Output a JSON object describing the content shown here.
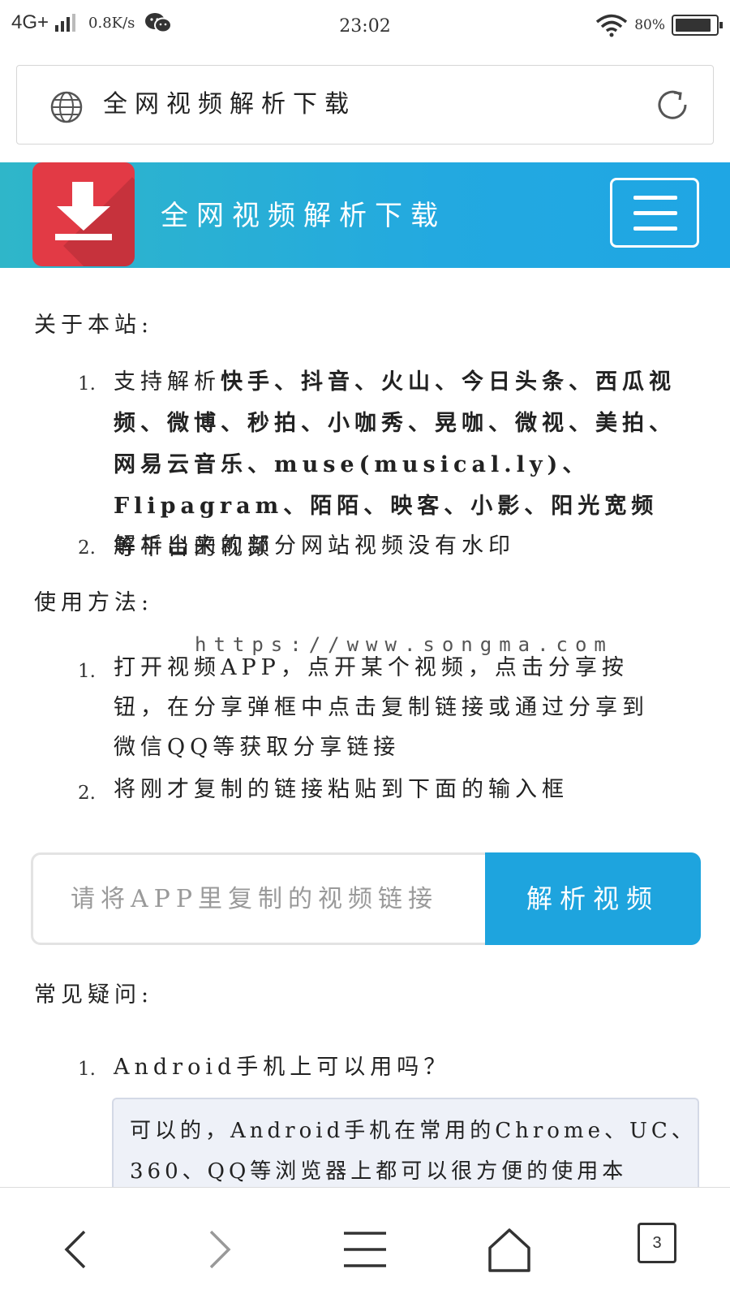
{
  "status_bar": {
    "network": "4G+",
    "speed": "0.8K/s",
    "time": "23:02",
    "battery": "80%"
  },
  "address_bar": {
    "title": "全网视频解析下载"
  },
  "site_header": {
    "title": "全网视频解析下载"
  },
  "about": {
    "title": "关于本站:",
    "items": [
      {
        "num": "1.",
        "prefix": "支持解析",
        "platforms": "快手、抖音、火山、今日头条、西瓜视频、微博、秒拍、小咖秀、晃咖、微视、美拍、网易云音乐、muse(musical.ly)、Flipagram、陌陌、映客、小影、阳光宽频",
        "suffix": "等平台的视频"
      },
      {
        "num": "2.",
        "text": "解析出来的部分网站视频没有水印"
      }
    ]
  },
  "usage": {
    "title": "使用方法:",
    "watermark": "https://www.songma.com",
    "items": [
      {
        "num": "1.",
        "text": "打开视频APP，点开某个视频，点击分享按钮，在分享弹框中点击复制链接或通过分享到微信QQ等获取分享链接"
      },
      {
        "num": "2.",
        "text": "将刚才复制的链接粘贴到下面的输入框"
      }
    ]
  },
  "parse_form": {
    "placeholder": "请将APP里复制的视频链接",
    "button_label": "解析视频"
  },
  "faq": {
    "title": "常见疑问:",
    "items": [
      {
        "num": "1.",
        "question": "Android手机上可以用吗？",
        "answer": "可以的，Android手机在常用的Chrome、UC、360、QQ等浏览器上都可以很方便的使用本"
      }
    ]
  },
  "bottom_nav": {
    "tab_count": "3"
  },
  "colors": {
    "header_blue": "#23a9e0",
    "logo_red": "#e23a45",
    "button_blue": "#1ea4de"
  }
}
